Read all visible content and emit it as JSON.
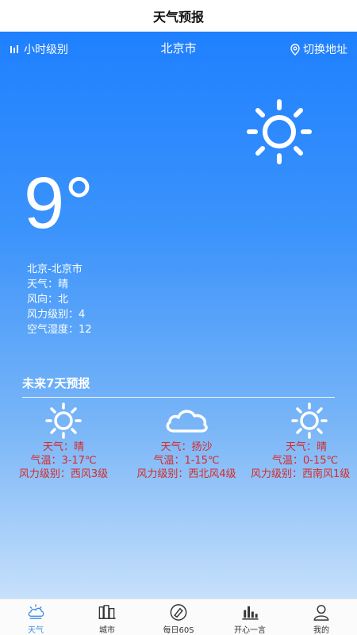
{
  "header": {
    "title": "天气预报"
  },
  "topbar": {
    "hourly_label": "小时级别",
    "city": "北京市",
    "switch_label": "切换地址"
  },
  "current": {
    "temperature": "9°",
    "location": "北京-北京市",
    "weather": "天气：晴",
    "wind_dir": "风向：北",
    "wind_level": "风力级别：4",
    "humidity": "空气湿度：12",
    "icon": "sun-icon"
  },
  "forecast": {
    "title": "未来7天预报",
    "days": [
      {
        "icon": "sun-icon",
        "weather": "天气：晴",
        "temp": "气温：3-17℃",
        "wind": "风力级别：西风3级"
      },
      {
        "icon": "cloud-icon",
        "weather": "天气：扬沙",
        "temp": "气温：1-15℃",
        "wind": "风力级别：西北风4级"
      },
      {
        "icon": "sun-icon",
        "weather": "天气：晴",
        "temp": "气温：0-15℃",
        "wind": "风力级别：西南风1级"
      }
    ]
  },
  "tabs": [
    {
      "label": "天气",
      "icon": "weather-icon",
      "active": true
    },
    {
      "label": "城市",
      "icon": "city-icon",
      "active": false
    },
    {
      "label": "每日60S",
      "icon": "news-icon",
      "active": false
    },
    {
      "label": "开心一言",
      "icon": "chart-icon",
      "active": false
    },
    {
      "label": "我的",
      "icon": "user-icon",
      "active": false
    }
  ],
  "colors": {
    "accent": "#3a8ee6",
    "forecast_text": "#d62a2a",
    "gradient_top": "#1f80ff",
    "gradient_bottom": "#c6e0fb"
  }
}
